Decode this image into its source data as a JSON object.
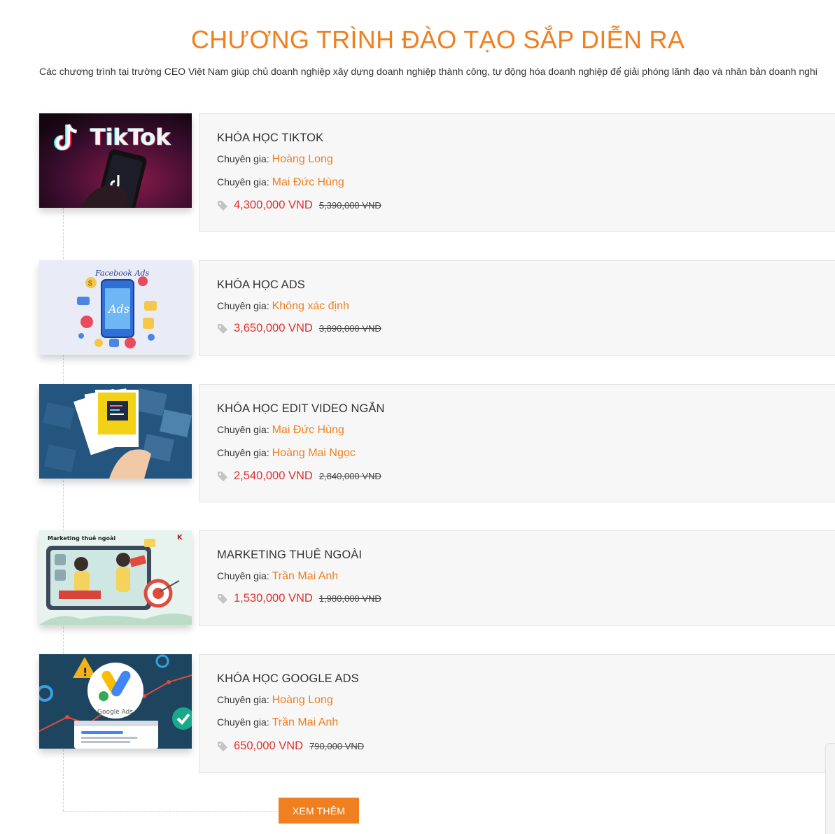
{
  "header": {
    "title": "CHƯƠNG TRÌNH ĐÀO TẠO SẮP DIỄN RA",
    "subtitle": "Các chương trình tại trường CEO Việt Nam giúp chủ doanh nghiệp xây dựng doanh nghiệp thành công, tự động hóa doanh nghiệp để giải phóng lãnh đạo và nhân bản doanh nghi"
  },
  "expert_label": "Chuyên gia: ",
  "courses": [
    {
      "name": "KHÓA HỌC TIKTOK",
      "experts": [
        "Hoàng Long",
        "Mai Đức Hùng"
      ],
      "price": "4,300,000 VND",
      "old_price": "5,390,000 VND",
      "thumb_text": "TikTok",
      "thumb_icon": "tiktok-logo-icon"
    },
    {
      "name": "KHÓA HỌC ADS",
      "experts": [
        "Không xác định"
      ],
      "price": "3,650,000 VND",
      "old_price": "3,890,000 VND",
      "thumb_text": "Facebook Ads",
      "thumb_icon": "phone-ads-icon"
    },
    {
      "name": "KHÓA HỌC EDIT VIDEO NGẮN",
      "experts": [
        "Mai Đức Hùng",
        "Hoàng Mai Ngọc"
      ],
      "price": "2,540,000 VND",
      "old_price": "2,840,000 VND",
      "thumb_icon": "photo-cards-icon"
    },
    {
      "name": "MARKETING THUÊ NGOÀI",
      "experts": [
        "Trần Mai Anh"
      ],
      "price": "1,530,000 VND",
      "old_price": "1,980,000 VND",
      "thumb_text": "Marketing thuê ngoài",
      "thumb_icon": "marketing-illustration-icon"
    },
    {
      "name": "KHÓA HỌC GOOGLE ADS",
      "experts": [
        "Hoàng Long",
        "Trần Mai Anh"
      ],
      "price": "650,000 VND",
      "old_price": "790,000 VND",
      "thumb_text": "Google Ads",
      "thumb_icon": "google-ads-logo-icon"
    }
  ],
  "more_button": "XEM THÊM",
  "colors": {
    "accent": "#f07f1f",
    "price": "#e0312e",
    "card_bg": "#f7f7f7"
  }
}
